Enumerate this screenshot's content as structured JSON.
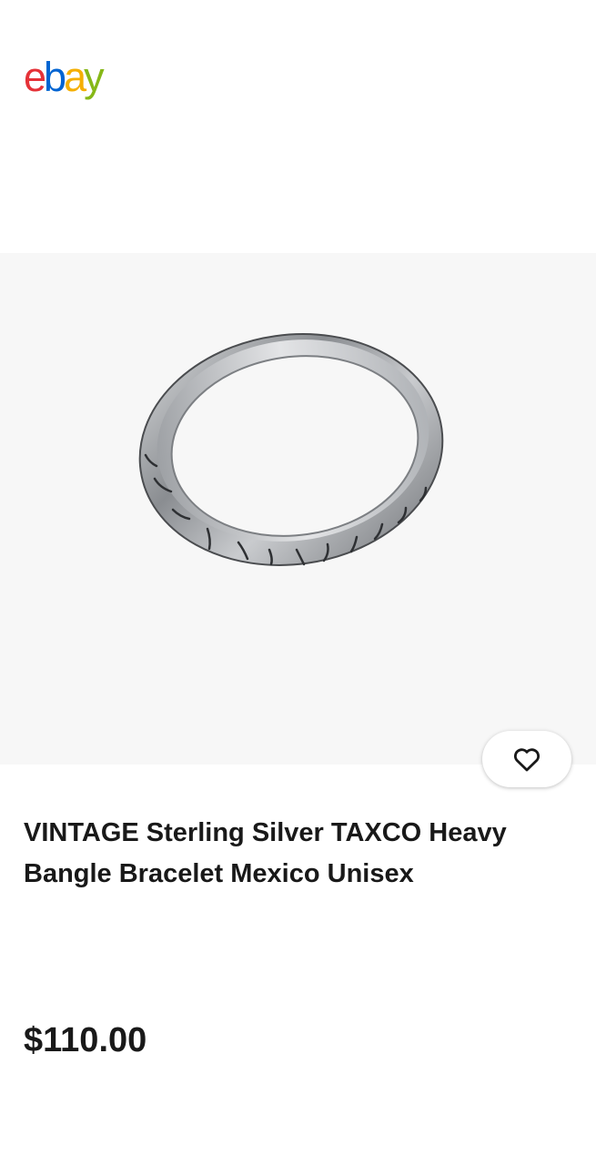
{
  "header": {
    "logo": {
      "letters": [
        "e",
        "b",
        "a",
        "y"
      ],
      "colors": [
        "#e53238",
        "#0064d2",
        "#f5af02",
        "#86b817"
      ]
    }
  },
  "listing": {
    "image": {
      "subject": "sterling silver bangle bracelet photo",
      "background": "#f7f7f7"
    },
    "watch_icon": "heart-icon",
    "title": "VINTAGE Sterling Silver TAXCO Heavy Bangle Bracelet Mexico Unisex",
    "price": "$110.00"
  }
}
